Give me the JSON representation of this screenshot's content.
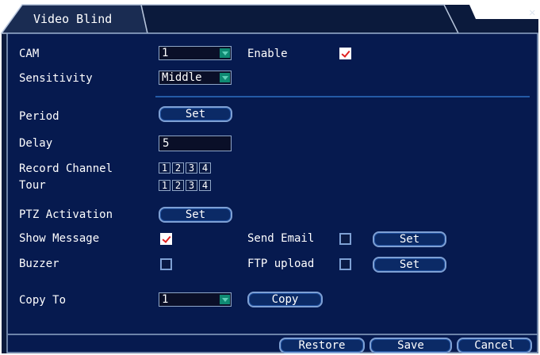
{
  "window": {
    "title": "Video Blind",
    "close_icon": "close-icon"
  },
  "fields": {
    "cam": {
      "label": "CAM",
      "value": "1"
    },
    "enable": {
      "label": "Enable",
      "checked": true
    },
    "sensitivity": {
      "label": "Sensitivity",
      "value": "Middle"
    },
    "period": {
      "label": "Period",
      "button": "Set"
    },
    "delay": {
      "label": "Delay",
      "value": "5"
    },
    "record_channel": {
      "label": "Record Channel",
      "channels": [
        "1",
        "2",
        "3",
        "4"
      ]
    },
    "tour": {
      "label": "Tour",
      "channels": [
        "1",
        "2",
        "3",
        "4"
      ]
    },
    "ptz_activation": {
      "label": "PTZ Activation",
      "button": "Set"
    },
    "show_message": {
      "label": "Show Message",
      "checked": true
    },
    "send_email": {
      "label": "Send Email",
      "checked": false,
      "button": "Set"
    },
    "buzzer": {
      "label": "Buzzer",
      "checked": false
    },
    "ftp_upload": {
      "label": "FTP upload",
      "checked": false,
      "button": "Set"
    },
    "copy_to": {
      "label": "Copy To",
      "value": "1",
      "button": "Copy"
    }
  },
  "footer": {
    "restore": "Restore",
    "save": "Save",
    "cancel": "Cancel"
  },
  "colors": {
    "panel_bg": "#061a4f",
    "border": "#8fa6c7",
    "check_mark": "#e02020",
    "dropdown_arrow": "#0f8a73"
  }
}
